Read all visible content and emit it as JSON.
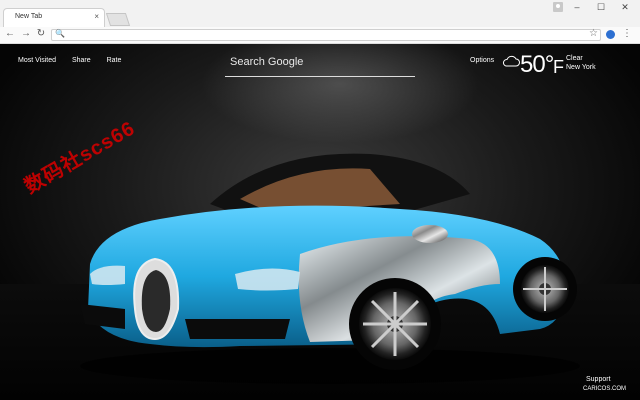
{
  "browser": {
    "tab_title": "New Tab",
    "tab_close": "×",
    "min": "–",
    "max": "☐",
    "close": "✕",
    "back": "←",
    "forward": "→",
    "reload": "↻",
    "search_icon": "🔍",
    "star": "☆",
    "menu": "⋮"
  },
  "page": {
    "links": [
      "Most Visited",
      "Share",
      "Rate"
    ],
    "search_placeholder": "Search Google",
    "options_label": "Options",
    "weather": {
      "temperature": "50°",
      "unit": "F",
      "condition": "Clear",
      "location": "New York",
      "icon": "cloud-icon"
    },
    "watermark": "数码社scs66",
    "support_label": "Support",
    "credit": "CARICOS.COM"
  },
  "colors": {
    "car_blue": "#1fa8e0",
    "watermark": "#d00000"
  }
}
